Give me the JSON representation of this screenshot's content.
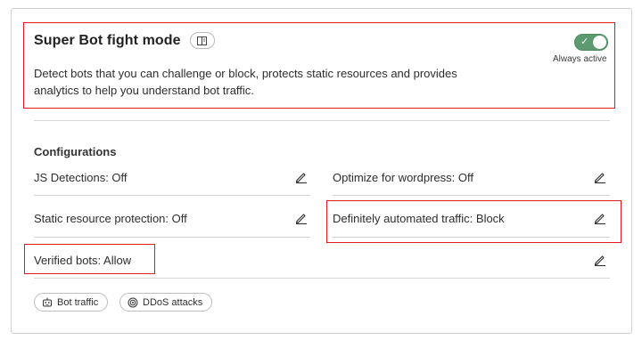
{
  "header": {
    "title": "Super Bot fight mode",
    "doc_icon": "book-icon",
    "toggle_state": "on",
    "toggle_caption": "Always active",
    "description": "Detect bots that you can challenge or block, protects static resources and provides analytics to help you understand bot traffic."
  },
  "configurations": {
    "heading": "Configurations",
    "items": [
      {
        "label": "JS Detections: Off"
      },
      {
        "label": "Optimize for wordpress: Off"
      },
      {
        "label": "Static resource protection: Off"
      },
      {
        "label": "Definitely automated traffic: Block"
      },
      {
        "label": "Verified bots: Allow"
      }
    ],
    "edit_icon": "pencil-icon"
  },
  "chips": [
    {
      "label": "Bot traffic",
      "icon": "robot-icon"
    },
    {
      "label": "DDoS attacks",
      "icon": "target-icon"
    }
  ],
  "colors": {
    "toggle_on": "#5d9a6f",
    "highlight": "#e0171c",
    "divider": "#d4d4d4"
  }
}
